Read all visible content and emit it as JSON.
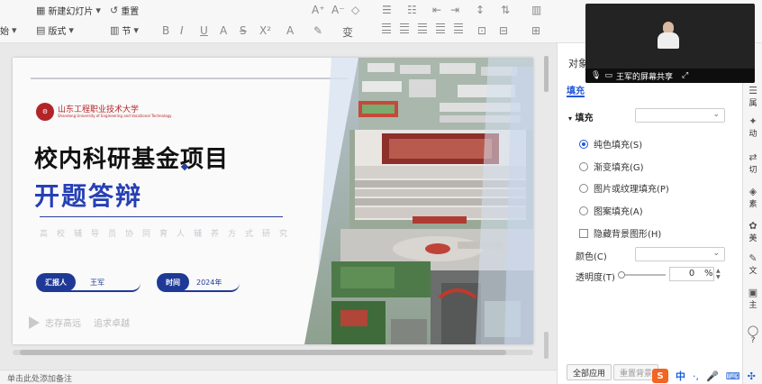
{
  "toolbar": {
    "row1": [
      {
        "label": "新建幻灯片",
        "icon": "new-slide-icon"
      },
      {
        "label": "重置",
        "icon": "reset-icon"
      }
    ],
    "row2": [
      {
        "label": "始",
        "icon": ""
      },
      {
        "label": "版式",
        "icon": "layout-icon"
      },
      {
        "label": "节",
        "icon": "section-icon"
      }
    ],
    "format_glyphs": [
      "B",
      "I",
      "U",
      "A",
      "S",
      "X²",
      "A",
      "✎",
      "变"
    ]
  },
  "slide": {
    "logo_text": "山东工程职业技术大学",
    "logo_sub": "Shandong University of Engineering and Vocational Technology",
    "title_line1": "校内科研基金项目",
    "title_line2": "开题答辩",
    "motto_faint": "高校辅导员协同育人辅养方式研究",
    "reporter_tag": "汇报人",
    "reporter_name": "王军",
    "time_tag": "时间",
    "time_value": "2024年",
    "slogan_1": "志存高远",
    "slogan_2": "追求卓越"
  },
  "notes_placeholder": "单击此处添加备注",
  "panel": {
    "title": "对象",
    "tab_fill": "填充",
    "section_fill": "填充",
    "options": [
      {
        "label": "纯色填充(S)",
        "checked": true,
        "type": "radio"
      },
      {
        "label": "渐变填充(G)",
        "checked": false,
        "type": "radio"
      },
      {
        "label": "图片或纹理填充(P)",
        "checked": false,
        "type": "radio"
      },
      {
        "label": "图案填充(A)",
        "checked": false,
        "type": "radio"
      },
      {
        "label": "隐藏背景图形(H)",
        "checked": false,
        "type": "checkbox"
      }
    ],
    "color_label": "颜色(C)",
    "transparency_label": "透明度(T)",
    "transparency_value": "0",
    "percent": "%",
    "apply_all": "全部应用",
    "reset_bg": "重置背景"
  },
  "strip": [
    {
      "label": "属",
      "icon": "properties-icon"
    },
    {
      "label": "动",
      "icon": "animation-icon"
    },
    {
      "label": "切",
      "icon": "transition-icon"
    },
    {
      "label": "素",
      "icon": "assets-icon"
    },
    {
      "label": "美",
      "icon": "beautify-icon"
    },
    {
      "label": "文",
      "icon": "text-icon"
    },
    {
      "label": "主",
      "icon": "theme-icon"
    },
    {
      "label": "?",
      "icon": "help-icon"
    }
  ],
  "camera": {
    "share_label": "王军的屏幕共享"
  },
  "tray": {
    "ime": "S",
    "lang": "中"
  }
}
